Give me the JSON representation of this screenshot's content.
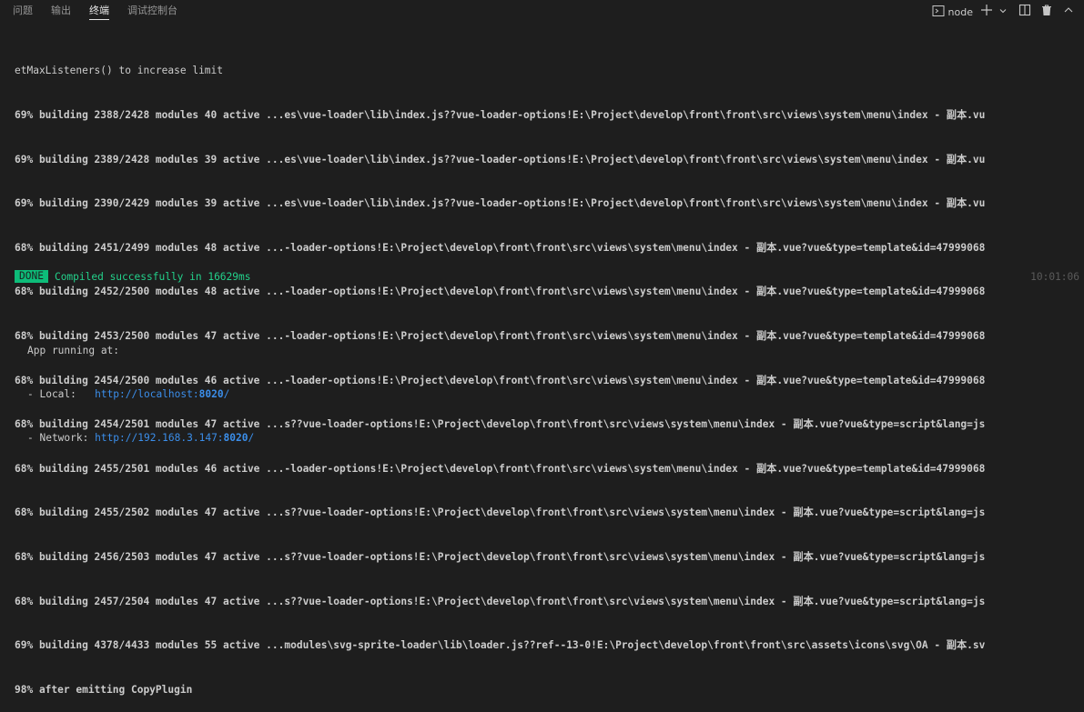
{
  "tabs": [
    {
      "label": "问题",
      "active": false
    },
    {
      "label": "输出",
      "active": false
    },
    {
      "label": "终端",
      "active": true
    },
    {
      "label": "调试控制台",
      "active": false
    }
  ],
  "toolbar": {
    "terminal_name": "node",
    "icons": [
      "terminal-icon",
      "plus-icon",
      "chevron-down-icon",
      "split-icon",
      "trash-icon",
      "chevron-up-icon"
    ]
  },
  "terminal": {
    "lines": [
      "etMaxListeners() to increase limit",
      "69% building 2388/2428 modules 40 active ...es\\vue-loader\\lib\\index.js??vue-loader-options!E:\\Project\\develop\\front\\front\\src\\views\\system\\menu\\index - 副本.vu",
      "69% building 2389/2428 modules 39 active ...es\\vue-loader\\lib\\index.js??vue-loader-options!E:\\Project\\develop\\front\\front\\src\\views\\system\\menu\\index - 副本.vu",
      "69% building 2390/2429 modules 39 active ...es\\vue-loader\\lib\\index.js??vue-loader-options!E:\\Project\\develop\\front\\front\\src\\views\\system\\menu\\index - 副本.vu",
      "68% building 2451/2499 modules 48 active ...-loader-options!E:\\Project\\develop\\front\\front\\src\\views\\system\\menu\\index - 副本.vue?vue&type=template&id=47999068",
      "68% building 2452/2500 modules 48 active ...-loader-options!E:\\Project\\develop\\front\\front\\src\\views\\system\\menu\\index - 副本.vue?vue&type=template&id=47999068",
      "68% building 2453/2500 modules 47 active ...-loader-options!E:\\Project\\develop\\front\\front\\src\\views\\system\\menu\\index - 副本.vue?vue&type=template&id=47999068",
      "68% building 2454/2500 modules 46 active ...-loader-options!E:\\Project\\develop\\front\\front\\src\\views\\system\\menu\\index - 副本.vue?vue&type=template&id=47999068",
      "68% building 2454/2501 modules 47 active ...s??vue-loader-options!E:\\Project\\develop\\front\\front\\src\\views\\system\\menu\\index - 副本.vue?vue&type=script&lang=js",
      "68% building 2455/2501 modules 46 active ...-loader-options!E:\\Project\\develop\\front\\front\\src\\views\\system\\menu\\index - 副本.vue?vue&type=template&id=47999068",
      "68% building 2455/2502 modules 47 active ...s??vue-loader-options!E:\\Project\\develop\\front\\front\\src\\views\\system\\menu\\index - 副本.vue?vue&type=script&lang=js",
      "68% building 2456/2503 modules 47 active ...s??vue-loader-options!E:\\Project\\develop\\front\\front\\src\\views\\system\\menu\\index - 副本.vue?vue&type=script&lang=js",
      "68% building 2457/2504 modules 47 active ...s??vue-loader-options!E:\\Project\\develop\\front\\front\\src\\views\\system\\menu\\index - 副本.vue?vue&type=script&lang=js",
      "69% building 4378/4433 modules 55 active ...modules\\svg-sprite-loader\\lib\\loader.js??ref--13-0!E:\\Project\\develop\\front\\front\\src\\assets\\icons\\svg\\OA - 副本.sv",
      "98% after emitting CopyPlugin"
    ],
    "done_badge": "DONE",
    "done_message": "Compiled successfully in 16629ms",
    "done_time": "10:01:06",
    "app_running": "App running at:",
    "local_label": "- Local:   ",
    "local_url_prefix": "http://localhost:",
    "local_port": "8020",
    "local_url_suffix": "/",
    "network_label": "- Network: ",
    "network_url_prefix": "http://192.168.3.147:",
    "network_port": "8020",
    "network_url_suffix": "/"
  },
  "colors": {
    "background": "#1e1e1e",
    "done_badge": "#0dbc79",
    "done_text": "#23d18b",
    "link": "#3b8eea"
  }
}
